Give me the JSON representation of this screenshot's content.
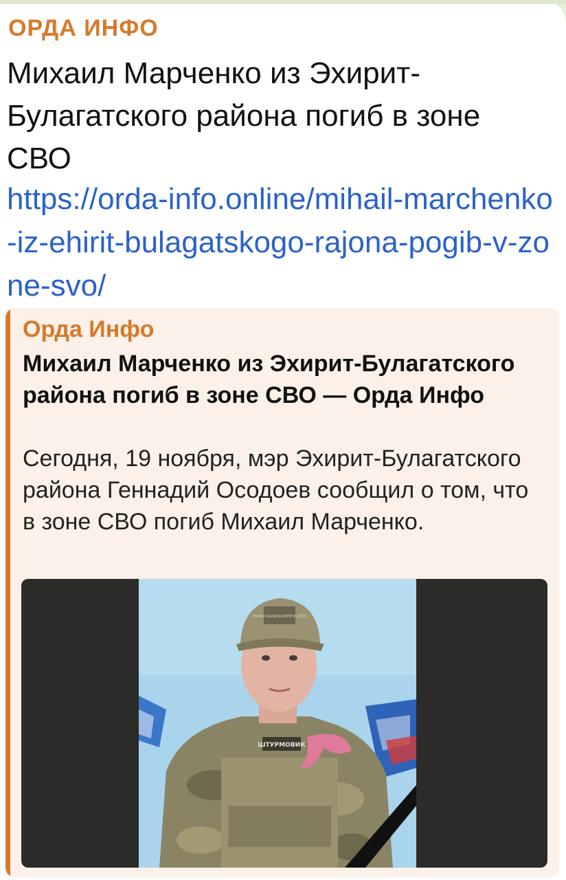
{
  "channel": {
    "name": "ОРДА ИНФО"
  },
  "message": {
    "text": "Михаил Марченко из Эхирит-Булагатского района погиб в зоне СВО",
    "link": "https://orda-info.online/mihail-marchenko-iz-ehirit-bulagatskogo-rajona-pogib-v-zone-svo/"
  },
  "preview": {
    "site_name": "Орда Инфо",
    "title": "Михаил Марченко из Эхирит-Булагатского района погиб в зоне СВО — Орда Инфо",
    "description": "Сегодня, 19 ноября, мэр Эхирит-Булагатского района Геннадий Осодоев сообщил о том, что в зоне СВО погиб Михаил Марченко.",
    "image_cap_text": "МАМА СКАЗАЛА БЕРЕГИ СЕБЯ",
    "image_patch_text": "ШТУРМОВИК"
  },
  "colors": {
    "accent": "#d57a2c",
    "link": "#2a62c9",
    "preview_bg": "#fbf1e8"
  }
}
